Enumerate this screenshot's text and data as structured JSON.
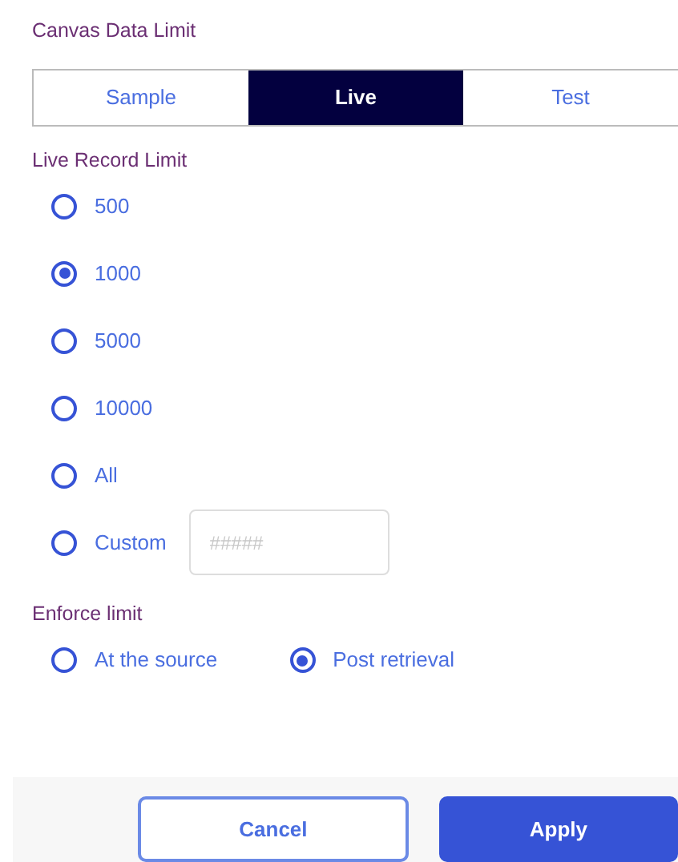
{
  "title": "Canvas Data Limit",
  "tabs": [
    {
      "label": "Sample",
      "selected": false
    },
    {
      "label": "Live",
      "selected": true
    },
    {
      "label": "Test",
      "selected": false
    }
  ],
  "record_limit": {
    "label": "Live Record Limit",
    "options": [
      {
        "label": "500",
        "selected": false
      },
      {
        "label": "1000",
        "selected": true
      },
      {
        "label": "5000",
        "selected": false
      },
      {
        "label": "10000",
        "selected": false
      },
      {
        "label": "All",
        "selected": false
      },
      {
        "label": "Custom",
        "selected": false,
        "placeholder": "#####"
      }
    ]
  },
  "enforce_limit": {
    "label": "Enforce limit",
    "options": [
      {
        "label": "At the source",
        "selected": false
      },
      {
        "label": "Post retrieval",
        "selected": true
      }
    ]
  },
  "buttons": [
    {
      "label": "Cancel",
      "kind": "secondary"
    },
    {
      "label": "Apply",
      "kind": "primary"
    }
  ]
}
